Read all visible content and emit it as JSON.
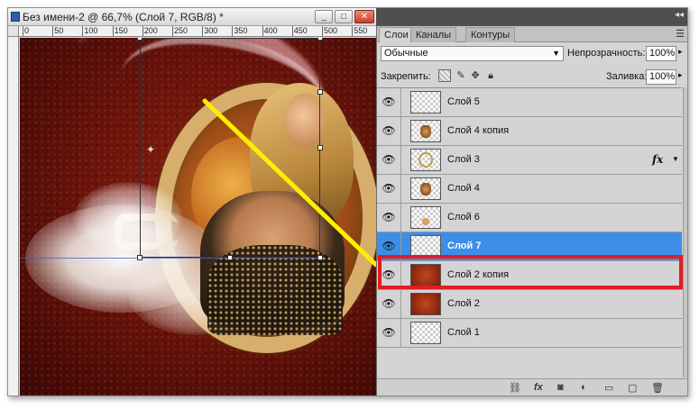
{
  "document": {
    "title": "Без имени-2 @ 66,7% (Слой 7, RGB/8) *",
    "window_buttons": {
      "minimize": "_",
      "maximize": "□",
      "close": "✕"
    }
  },
  "ruler": {
    "top_ticks": [
      "0",
      "50",
      "100",
      "150",
      "200",
      "250",
      "300",
      "350",
      "400",
      "450",
      "500",
      "550"
    ]
  },
  "panel": {
    "tabs": [
      "Слои",
      "Каналы",
      "Контуры"
    ],
    "active_tab": "Слои",
    "collapse_icon": "◂◂",
    "menu_icon": "☰"
  },
  "layers_panel": {
    "blend_mode": "Обычные",
    "opacity_label": "Непрозрачность:",
    "opacity_value": "100%",
    "lock_label": "Закрепить:",
    "fill_label": "Заливка:",
    "fill_value": "100%",
    "layers": [
      {
        "name": "Слой 5",
        "fx": "",
        "selected": false
      },
      {
        "name": "Слой 4 копия",
        "fx": "",
        "selected": false
      },
      {
        "name": "Слой 3",
        "fx": "fx",
        "selected": false
      },
      {
        "name": "Слой 4",
        "fx": "",
        "selected": false
      },
      {
        "name": "Слой 6",
        "fx": "",
        "selected": false
      },
      {
        "name": "Слой 7",
        "fx": "",
        "selected": true
      },
      {
        "name": "Слой 2 копия",
        "fx": "",
        "selected": false
      },
      {
        "name": "Слой 2",
        "fx": "",
        "selected": false
      },
      {
        "name": "Слой 1",
        "fx": "",
        "selected": false
      }
    ]
  },
  "icons": {
    "eye": "visibility-eye-icon",
    "link": "link-layers-icon",
    "fx": "layer-style-icon",
    "mask": "add-mask-icon",
    "adjust": "adjustment-layer-icon",
    "group": "new-group-icon",
    "new": "new-layer-icon",
    "trash": "delete-layer-icon"
  },
  "colors": {
    "selection": "#3d8ee8",
    "highlight": "#e31b23",
    "annotation_line": "#ffee00"
  }
}
